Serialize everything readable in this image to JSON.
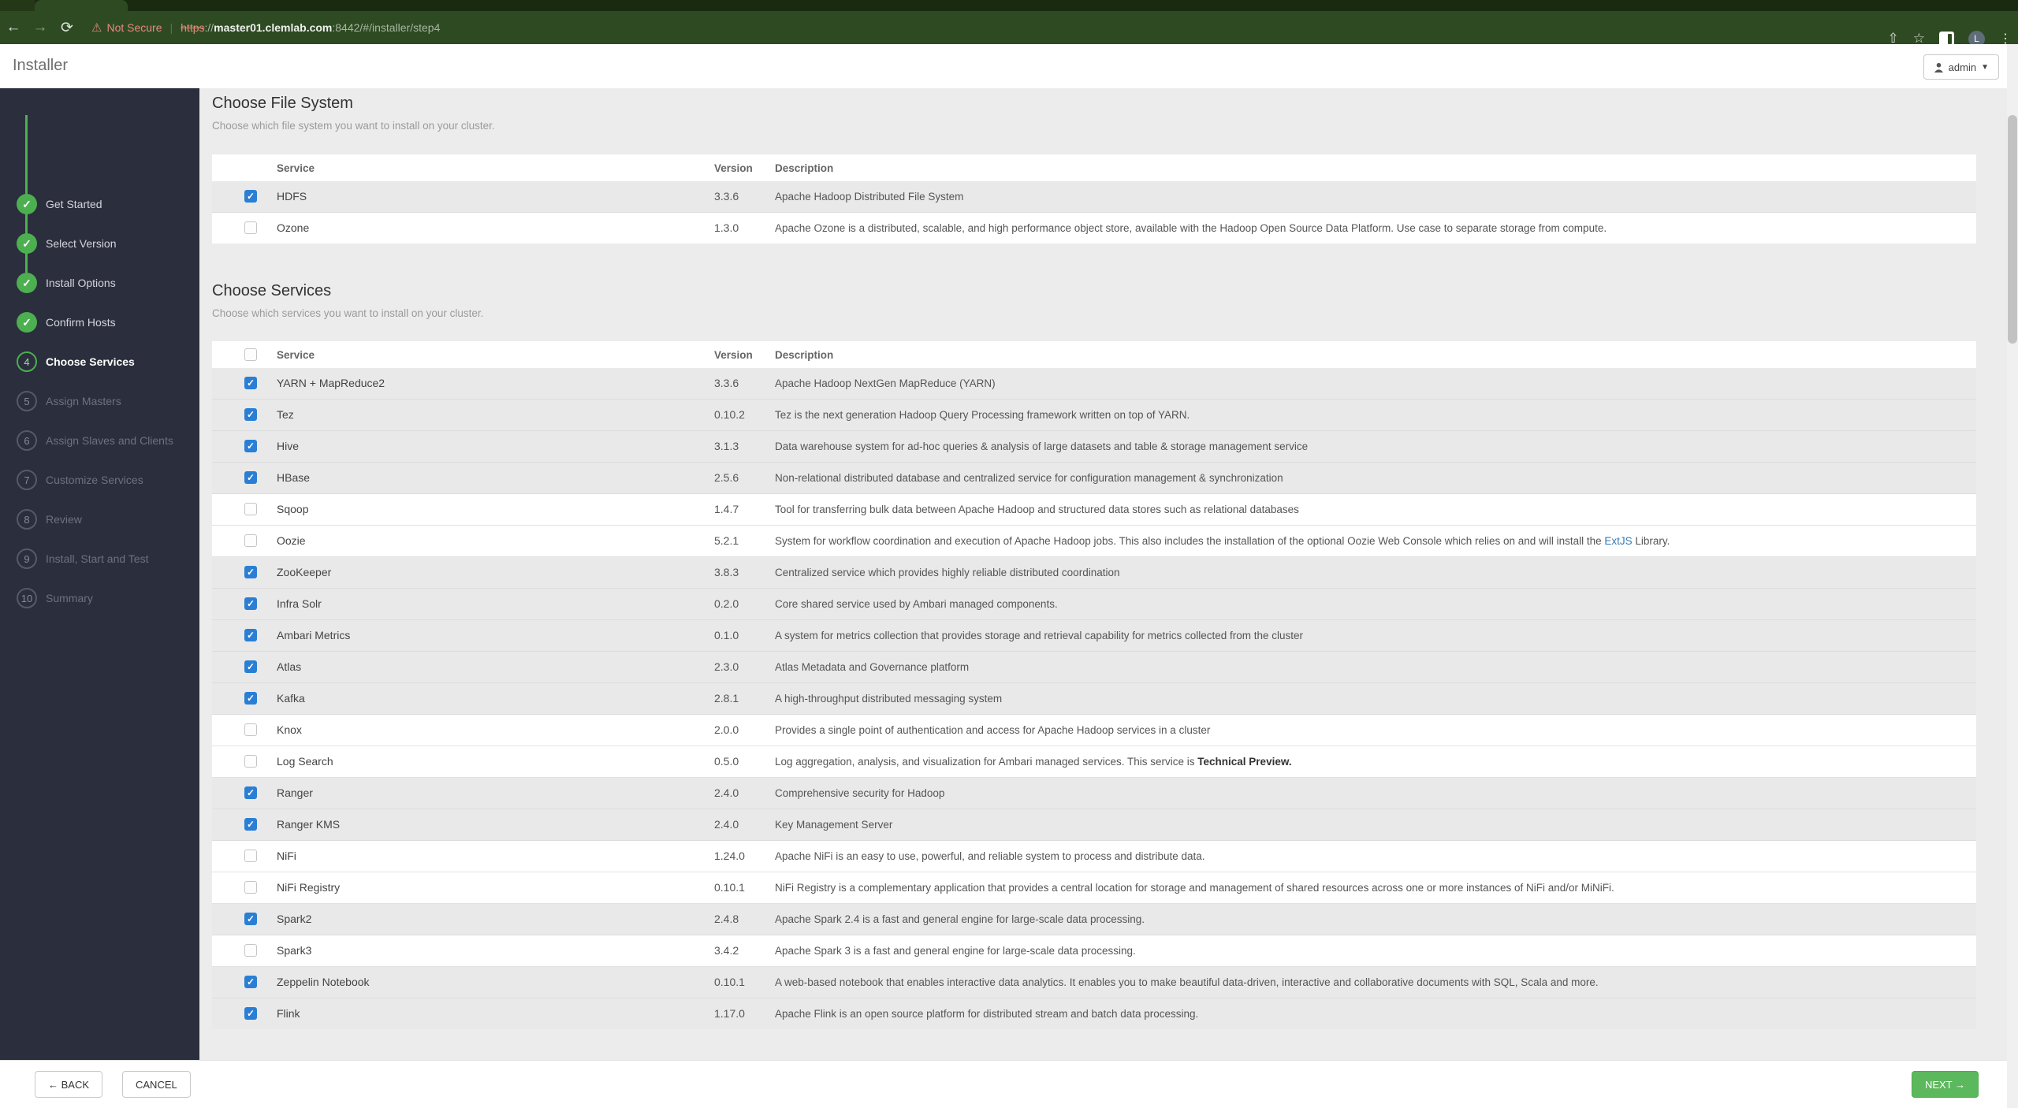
{
  "browser": {
    "not_secure": "Not Secure",
    "url_scheme": "https",
    "url_sep": "://",
    "url_host": "master01.clemlab.com",
    "url_rest": ":8442/#/installer/step4",
    "avatar_letter": "L",
    "back_glyph": "←",
    "forward_glyph": "→",
    "refresh_glyph": "⟳",
    "share_glyph": "⇧",
    "star_glyph": "☆",
    "kebab_glyph": "⋮",
    "warn_glyph": "⚠"
  },
  "header": {
    "title": "Installer",
    "user_label": "admin"
  },
  "sidebar": {
    "steps": [
      {
        "label": "Get Started",
        "status": "done"
      },
      {
        "label": "Select Version",
        "status": "done"
      },
      {
        "label": "Install Options",
        "status": "done"
      },
      {
        "label": "Confirm Hosts",
        "status": "done"
      },
      {
        "label": "Choose Services",
        "status": "current",
        "number": "4"
      },
      {
        "label": "Assign Masters",
        "status": "todo",
        "number": "5"
      },
      {
        "label": "Assign Slaves and Clients",
        "status": "todo",
        "number": "6"
      },
      {
        "label": "Customize Services",
        "status": "todo",
        "number": "7"
      },
      {
        "label": "Review",
        "status": "todo",
        "number": "8"
      },
      {
        "label": "Install, Start and Test",
        "status": "todo",
        "number": "9"
      },
      {
        "label": "Summary",
        "status": "todo",
        "number": "10"
      }
    ]
  },
  "file_system_section": {
    "title": "Choose File System",
    "subtitle": "Choose which file system you want to install on your cluster.",
    "columns": {
      "service": "Service",
      "version": "Version",
      "description": "Description"
    },
    "header_checkbox": false,
    "rows": [
      {
        "name": "HDFS",
        "version": "3.3.6",
        "checked": true,
        "desc": [
          {
            "text": "Apache Hadoop Distributed File System"
          }
        ]
      },
      {
        "name": "Ozone",
        "version": "1.3.0",
        "checked": false,
        "desc": [
          {
            "text": "Apache Ozone is a distributed, scalable, and high performance object store, available with the Hadoop Open Source Data Platform. Use case to separate storage from compute."
          }
        ]
      }
    ]
  },
  "services_section": {
    "title": "Choose Services",
    "subtitle": "Choose which services you want to install on your cluster.",
    "columns": {
      "service": "Service",
      "version": "Version",
      "description": "Description"
    },
    "header_checkbox": true,
    "rows": [
      {
        "name": "YARN + MapReduce2",
        "version": "3.3.6",
        "checked": true,
        "desc": [
          {
            "text": "Apache Hadoop NextGen MapReduce (YARN)"
          }
        ]
      },
      {
        "name": "Tez",
        "version": "0.10.2",
        "checked": true,
        "desc": [
          {
            "text": "Tez is the next generation Hadoop Query Processing framework written on top of YARN."
          }
        ]
      },
      {
        "name": "Hive",
        "version": "3.1.3",
        "checked": true,
        "desc": [
          {
            "text": "Data warehouse system for ad-hoc queries & analysis of large datasets and table & storage management service"
          }
        ]
      },
      {
        "name": "HBase",
        "version": "2.5.6",
        "checked": true,
        "desc": [
          {
            "text": "Non-relational distributed database and centralized service for configuration management & synchronization"
          }
        ]
      },
      {
        "name": "Sqoop",
        "version": "1.4.7",
        "checked": false,
        "desc": [
          {
            "text": "Tool for transferring bulk data between Apache Hadoop and structured data stores such as relational databases"
          }
        ]
      },
      {
        "name": "Oozie",
        "version": "5.2.1",
        "checked": false,
        "desc": [
          {
            "text": "System for workflow coordination and execution of Apache Hadoop jobs. This also includes the installation of the optional Oozie Web Console which relies on and will install the "
          },
          {
            "text": "ExtJS",
            "style": "link"
          },
          {
            "text": " Library."
          }
        ]
      },
      {
        "name": "ZooKeeper",
        "version": "3.8.3",
        "checked": true,
        "desc": [
          {
            "text": "Centralized service which provides highly reliable distributed coordination"
          }
        ]
      },
      {
        "name": "Infra Solr",
        "version": "0.2.0",
        "checked": true,
        "desc": [
          {
            "text": "Core shared service used by Ambari managed components."
          }
        ]
      },
      {
        "name": "Ambari Metrics",
        "version": "0.1.0",
        "checked": true,
        "desc": [
          {
            "text": "A system for metrics collection that provides storage and retrieval capability for metrics collected from the cluster"
          }
        ]
      },
      {
        "name": "Atlas",
        "version": "2.3.0",
        "checked": true,
        "desc": [
          {
            "text": "Atlas Metadata and Governance platform"
          }
        ]
      },
      {
        "name": "Kafka",
        "version": "2.8.1",
        "checked": true,
        "desc": [
          {
            "text": "A high-throughput distributed messaging system"
          }
        ]
      },
      {
        "name": "Knox",
        "version": "2.0.0",
        "checked": false,
        "desc": [
          {
            "text": "Provides a single point of authentication and access for Apache Hadoop services in a cluster"
          }
        ]
      },
      {
        "name": "Log Search",
        "version": "0.5.0",
        "checked": false,
        "desc": [
          {
            "text": "Log aggregation, analysis, and visualization for Ambari managed services. This service is "
          },
          {
            "text": "Technical Preview.",
            "style": "bold"
          }
        ]
      },
      {
        "name": "Ranger",
        "version": "2.4.0",
        "checked": true,
        "desc": [
          {
            "text": "Comprehensive security for Hadoop"
          }
        ]
      },
      {
        "name": "Ranger KMS",
        "version": "2.4.0",
        "checked": true,
        "desc": [
          {
            "text": "Key Management Server"
          }
        ]
      },
      {
        "name": "NiFi",
        "version": "1.24.0",
        "checked": false,
        "desc": [
          {
            "text": "Apache NiFi is an easy to use, powerful, and reliable system to process and distribute data."
          }
        ]
      },
      {
        "name": "NiFi Registry",
        "version": "0.10.1",
        "checked": false,
        "desc": [
          {
            "text": "NiFi Registry is a complementary application that provides a central location for storage and management of shared resources across one or more instances of NiFi and/or MiNiFi."
          }
        ]
      },
      {
        "name": "Spark2",
        "version": "2.4.8",
        "checked": true,
        "desc": [
          {
            "text": "Apache Spark 2.4 is a fast and general engine for large-scale data processing."
          }
        ]
      },
      {
        "name": "Spark3",
        "version": "3.4.2",
        "checked": false,
        "desc": [
          {
            "text": "Apache Spark 3 is a fast and general engine for large-scale data processing."
          }
        ]
      },
      {
        "name": "Zeppelin Notebook",
        "version": "0.10.1",
        "checked": true,
        "desc": [
          {
            "text": "A web-based notebook that enables interactive data analytics. It enables you to make beautiful data-driven, interactive and collaborative documents with SQL, Scala and more."
          }
        ]
      },
      {
        "name": "Flink",
        "version": "1.17.0",
        "checked": true,
        "desc": [
          {
            "text": "Apache Flink is an open source platform for distributed stream and batch data processing."
          }
        ]
      }
    ]
  },
  "footer": {
    "back": "← BACK",
    "cancel": "CANCEL",
    "next": "NEXT →"
  }
}
